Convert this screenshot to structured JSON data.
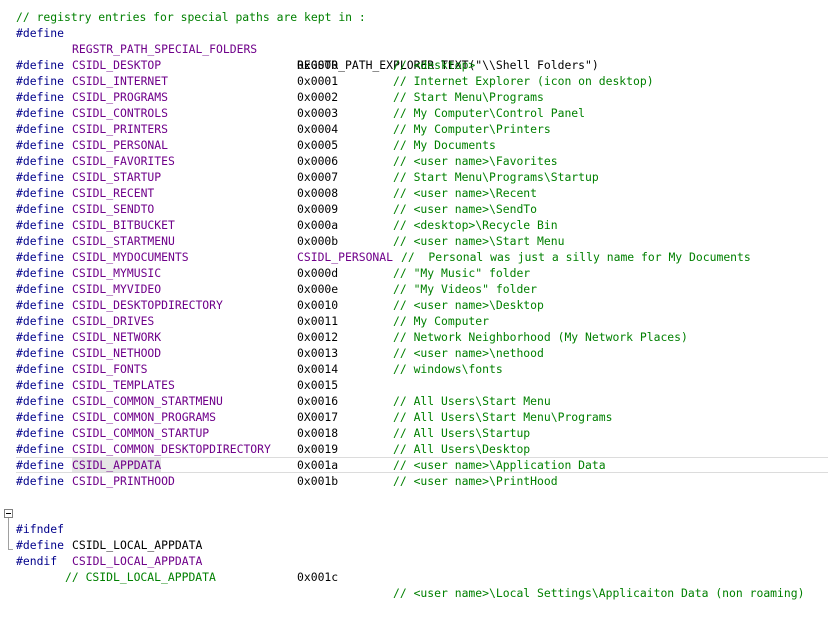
{
  "line0": {
    "text": "// registry entries for special paths are kept in :"
  },
  "line1": {
    "directive": "#define",
    "name": "REGSTR_PATH_SPECIAL_FOLDERS",
    "macro": "REGSTR_PATH_EXPLORER",
    "func": "TEXT",
    "str": "(\"\\\\Shell Folders\")"
  },
  "defines": [
    {
      "directive": "#define",
      "name": "CSIDL_DESKTOP",
      "value": "0x0000",
      "comment": "// <desktop>"
    },
    {
      "directive": "#define",
      "name": "CSIDL_INTERNET",
      "value": "0x0001",
      "comment": "// Internet Explorer (icon on desktop)"
    },
    {
      "directive": "#define",
      "name": "CSIDL_PROGRAMS",
      "value": "0x0002",
      "comment": "// Start Menu\\Programs"
    },
    {
      "directive": "#define",
      "name": "CSIDL_CONTROLS",
      "value": "0x0003",
      "comment": "// My Computer\\Control Panel"
    },
    {
      "directive": "#define",
      "name": "CSIDL_PRINTERS",
      "value": "0x0004",
      "comment": "// My Computer\\Printers"
    },
    {
      "directive": "#define",
      "name": "CSIDL_PERSONAL",
      "value": "0x0005",
      "comment": "// My Documents"
    },
    {
      "directive": "#define",
      "name": "CSIDL_FAVORITES",
      "value": "0x0006",
      "comment": "// <user name>\\Favorites"
    },
    {
      "directive": "#define",
      "name": "CSIDL_STARTUP",
      "value": "0x0007",
      "comment": "// Start Menu\\Programs\\Startup"
    },
    {
      "directive": "#define",
      "name": "CSIDL_RECENT",
      "value": "0x0008",
      "comment": "// <user name>\\Recent"
    },
    {
      "directive": "#define",
      "name": "CSIDL_SENDTO",
      "value": "0x0009",
      "comment": "// <user name>\\SendTo"
    },
    {
      "directive": "#define",
      "name": "CSIDL_BITBUCKET",
      "value": "0x000a",
      "comment": "// <desktop>\\Recycle Bin"
    },
    {
      "directive": "#define",
      "name": "CSIDL_STARTMENU",
      "value": "0x000b",
      "comment": "// <user name>\\Start Menu"
    },
    {
      "directive": "#define",
      "name": "CSIDL_MYDOCUMENTS",
      "value": "CSIDL_PERSONAL",
      "comment": "//  Personal was just a silly name for My Documents"
    },
    {
      "directive": "#define",
      "name": "CSIDL_MYMUSIC",
      "value": "0x000d",
      "comment": "// \"My Music\" folder"
    },
    {
      "directive": "#define",
      "name": "CSIDL_MYVIDEO",
      "value": "0x000e",
      "comment": "// \"My Videos\" folder"
    },
    {
      "directive": "#define",
      "name": "CSIDL_DESKTOPDIRECTORY",
      "value": "0x0010",
      "comment": "// <user name>\\Desktop"
    },
    {
      "directive": "#define",
      "name": "CSIDL_DRIVES",
      "value": "0x0011",
      "comment": "// My Computer"
    },
    {
      "directive": "#define",
      "name": "CSIDL_NETWORK",
      "value": "0x0012",
      "comment": "// Network Neighborhood (My Network Places)"
    },
    {
      "directive": "#define",
      "name": "CSIDL_NETHOOD",
      "value": "0x0013",
      "comment": "// <user name>\\nethood"
    },
    {
      "directive": "#define",
      "name": "CSIDL_FONTS",
      "value": "0x0014",
      "comment": "// windows\\fonts"
    },
    {
      "directive": "#define",
      "name": "CSIDL_TEMPLATES",
      "value": "0x0015",
      "comment": ""
    },
    {
      "directive": "#define",
      "name": "CSIDL_COMMON_STARTMENU",
      "value": "0x0016",
      "comment": "// All Users\\Start Menu"
    },
    {
      "directive": "#define",
      "name": "CSIDL_COMMON_PROGRAMS",
      "value": "0X0017",
      "comment": "// All Users\\Start Menu\\Programs"
    },
    {
      "directive": "#define",
      "name": "CSIDL_COMMON_STARTUP",
      "value": "0x0018",
      "comment": "// All Users\\Startup"
    },
    {
      "directive": "#define",
      "name": "CSIDL_COMMON_DESKTOPDIRECTORY",
      "value": "0x0019",
      "comment": "// All Users\\Desktop"
    },
    {
      "directive": "#define",
      "name": "CSIDL_APPDATA",
      "value": "0x001a",
      "comment": "// <user name>\\Application Data"
    },
    {
      "directive": "#define",
      "name": "CSIDL_PRINTHOOD",
      "value": "0x001b",
      "comment": "// <user name>\\PrintHood"
    }
  ],
  "ifndef": {
    "directive": "#ifndef",
    "name": "CSIDL_LOCAL_APPDATA"
  },
  "local": {
    "directive": "#define",
    "name": "CSIDL_LOCAL_APPDATA",
    "value": "0x001c",
    "comment": "// <user name>\\Local Settings\\Applicaiton Data (non roaming)"
  },
  "endif": {
    "directive": "#endif",
    "comment": "// CSIDL_LOCAL_APPDATA"
  },
  "colors": {
    "preprocessor": "#00008b",
    "identifier": "#6f008a",
    "comment": "#008000"
  }
}
